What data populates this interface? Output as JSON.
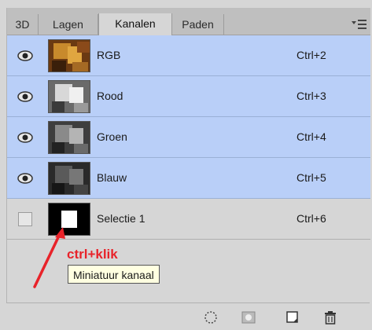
{
  "tabs": [
    {
      "label": "3D",
      "active": false
    },
    {
      "label": "Lagen",
      "active": false
    },
    {
      "label": "Kanalen",
      "active": true
    },
    {
      "label": "Paden",
      "active": false
    }
  ],
  "channels": [
    {
      "name": "RGB",
      "shortcut": "Ctrl+2",
      "visible": true,
      "selected": true
    },
    {
      "name": "Rood",
      "shortcut": "Ctrl+3",
      "visible": true,
      "selected": true
    },
    {
      "name": "Groen",
      "shortcut": "Ctrl+4",
      "visible": true,
      "selected": true
    },
    {
      "name": "Blauw",
      "shortcut": "Ctrl+5",
      "visible": true,
      "selected": true
    },
    {
      "name": "Selectie 1",
      "shortcut": "Ctrl+6",
      "visible": false,
      "selected": false
    }
  ],
  "annotation": {
    "text": "ctrl+klik",
    "color": "#e8232a"
  },
  "tooltip": {
    "text": "Miniatuur kanaal"
  },
  "bottom_buttons": [
    "load-selection-icon",
    "save-selection-icon",
    "new-channel-icon",
    "trash-icon"
  ],
  "colors": {
    "selected_row": "#b9cff8",
    "panel_bg": "#d6d6d6",
    "tab_bg": "#bfbfbf"
  }
}
